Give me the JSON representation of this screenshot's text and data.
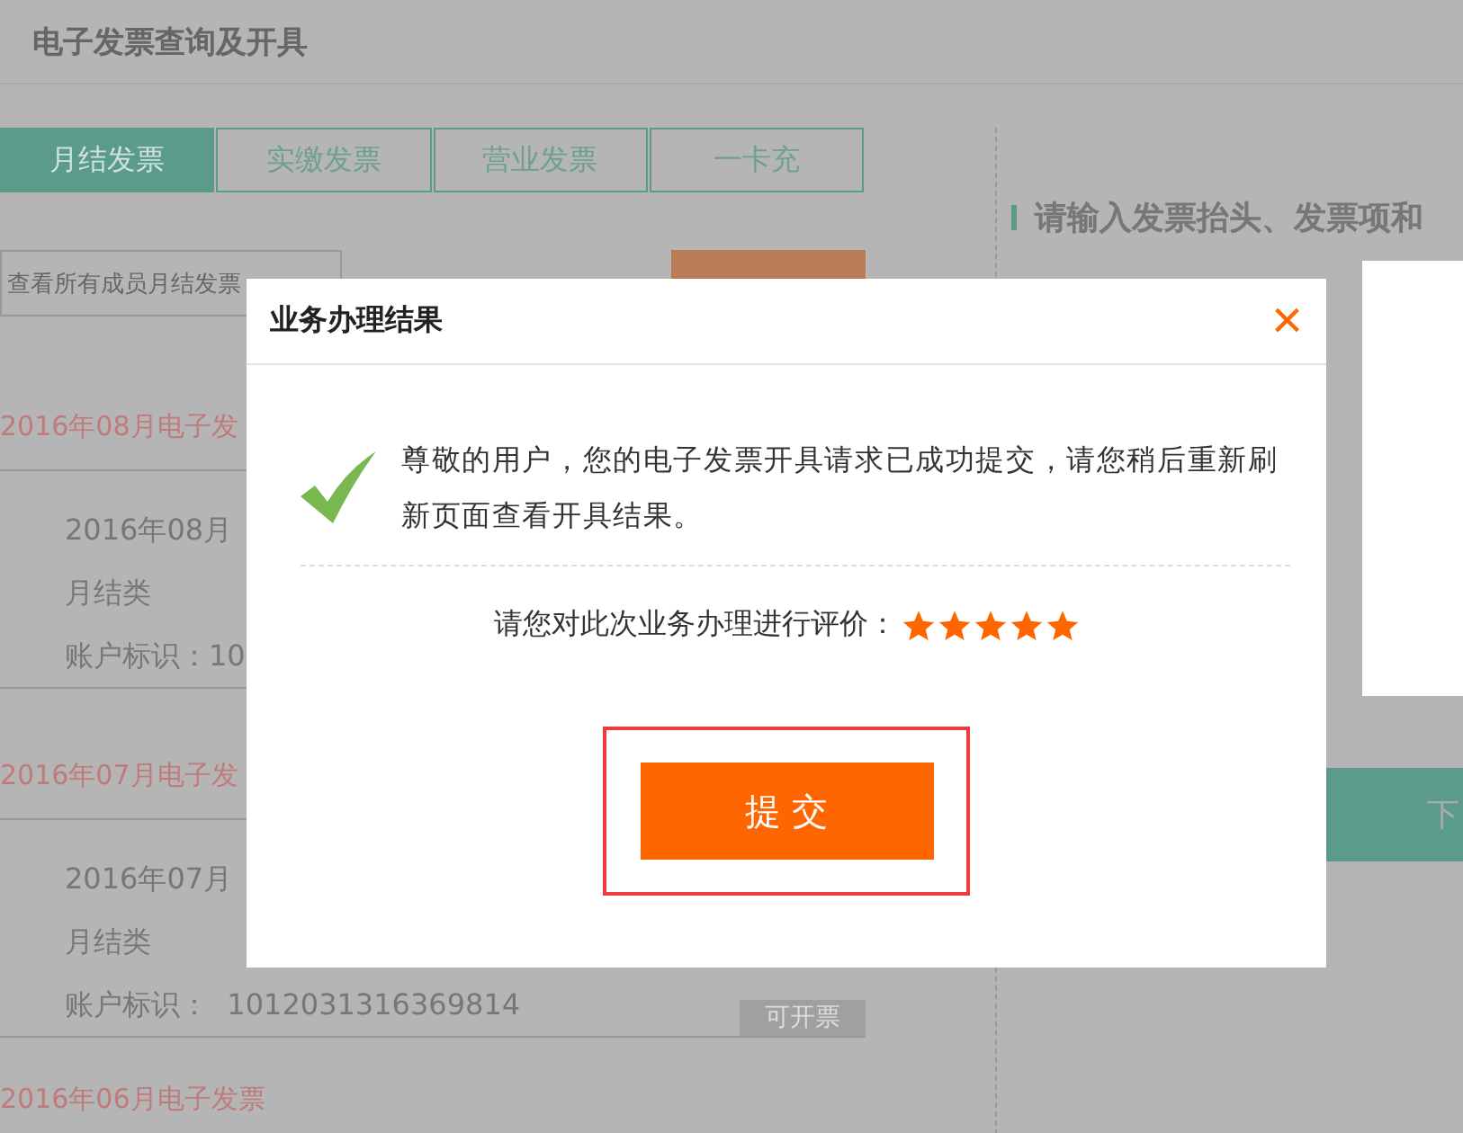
{
  "page_title": "电子发票查询及开具",
  "tabs": [
    {
      "label": "月结发票",
      "selected": true
    },
    {
      "label": "实缴发票",
      "selected": false
    },
    {
      "label": "营业发票",
      "selected": false
    },
    {
      "label": "一卡充",
      "selected": false
    }
  ],
  "member_select": {
    "value": "查看所有成员月结发票"
  },
  "invoice_groups": [
    {
      "heading": "2016年08月电子发",
      "month": "2016年08月",
      "type": "月结类",
      "account": "账户标识：10"
    },
    {
      "heading": "2016年07月电子发",
      "month": "2016年07月",
      "type": "月结类",
      "account": "账户标识：  1012031316369814",
      "status": "可开票"
    },
    {
      "heading": "2016年06月电子发票"
    }
  ],
  "right_panel": {
    "heading": "请输入发票抬头、发票项和",
    "next_button": "下"
  },
  "dialog": {
    "title": "业务办理结果",
    "close": "×",
    "message": "尊敬的用户，您的电子发票开具请求已成功提交，请您稍后重新刷新页面查看开具结果。",
    "rating_label": "请您对此次业务办理进行评价：",
    "stars": 5,
    "submit_button": "提 交"
  }
}
